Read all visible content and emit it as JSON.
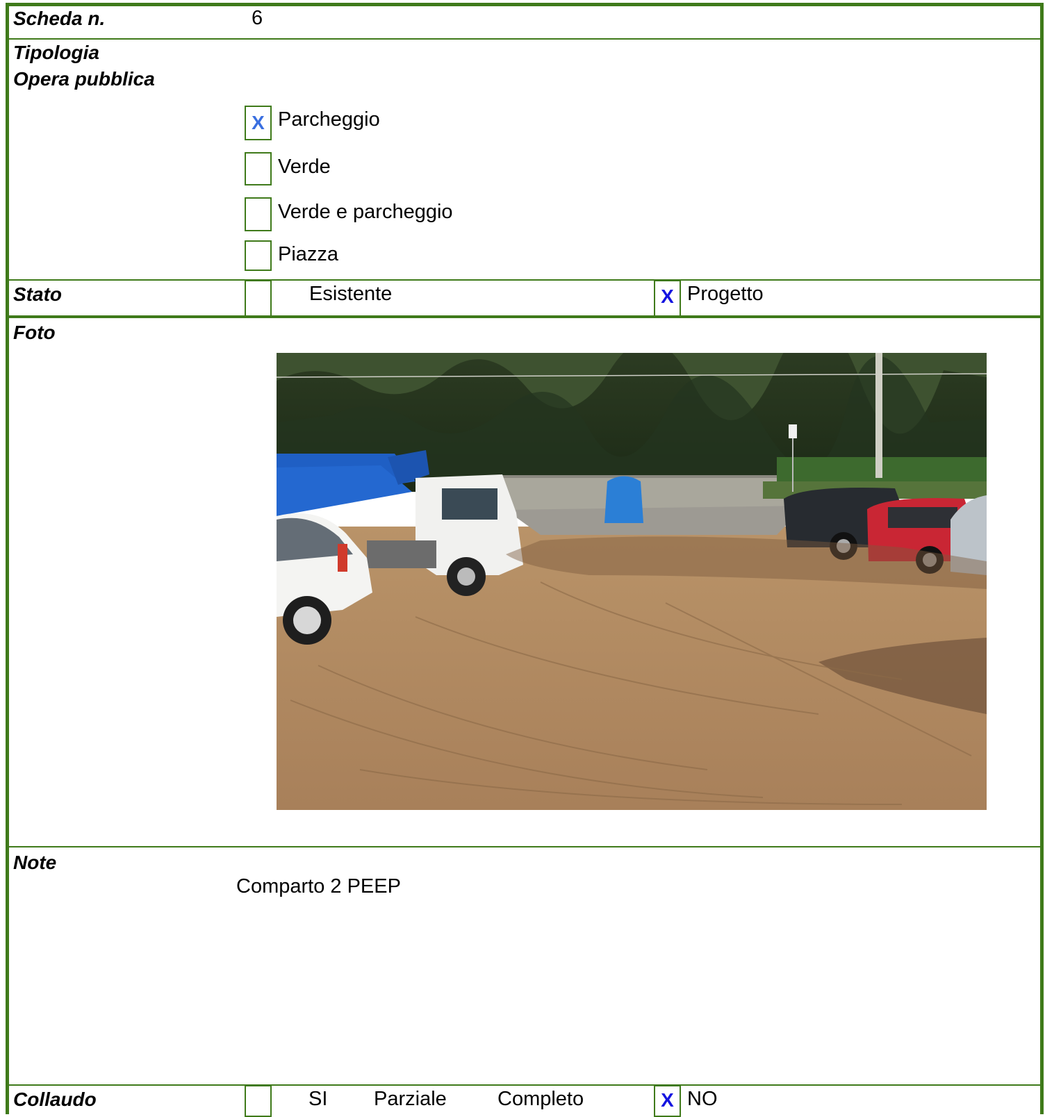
{
  "scheda": {
    "label": "Scheda n.",
    "value": "6"
  },
  "tipologia": {
    "label_line1": "Tipologia",
    "label_line2": "Opera pubblica",
    "options": [
      {
        "label": "Parcheggio",
        "checked": true,
        "mark": "X"
      },
      {
        "label": "Verde",
        "checked": false,
        "mark": ""
      },
      {
        "label": "Verde e parcheggio",
        "checked": false,
        "mark": ""
      },
      {
        "label": "Piazza",
        "checked": false,
        "mark": ""
      }
    ]
  },
  "stato": {
    "label": "Stato",
    "existing_label": "Esistente",
    "existing_mark": "",
    "project_label": "Progetto",
    "project_mark": "X"
  },
  "foto": {
    "label": "Foto"
  },
  "note": {
    "label": "Note",
    "text": "Comparto 2 PEEP"
  },
  "collaudo": {
    "label": "Collaudo",
    "mark_left": "",
    "opt_si": "SI",
    "opt_parziale": "Parziale",
    "opt_completo": "Completo",
    "mark_no": "X",
    "opt_no": "NO"
  },
  "colors": {
    "border": "#3f7a1a",
    "mark_light": "#3a6fe0",
    "mark_dark": "#1414e0"
  }
}
